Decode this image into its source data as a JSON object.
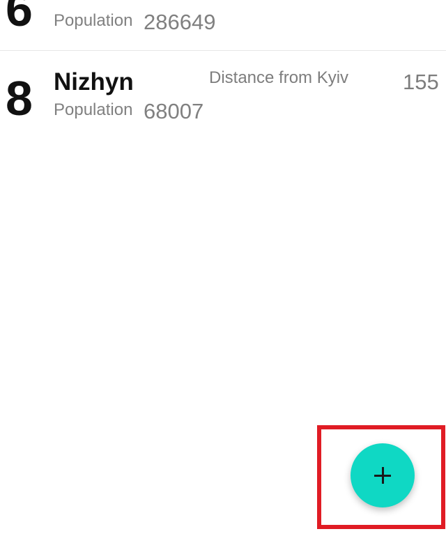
{
  "cities": [
    {
      "rank": "6",
      "name": "",
      "population_label": "Population",
      "population": "286649",
      "distance_label": "",
      "distance": ""
    },
    {
      "rank": "8",
      "name": "Nizhyn",
      "population_label": "Population",
      "population": "68007",
      "distance_label": "Distance from Kyiv",
      "distance": "155"
    }
  ],
  "fab": {
    "icon": "plus-icon",
    "color": "#0fd8c4"
  },
  "highlight": {
    "color": "#e01c24"
  }
}
